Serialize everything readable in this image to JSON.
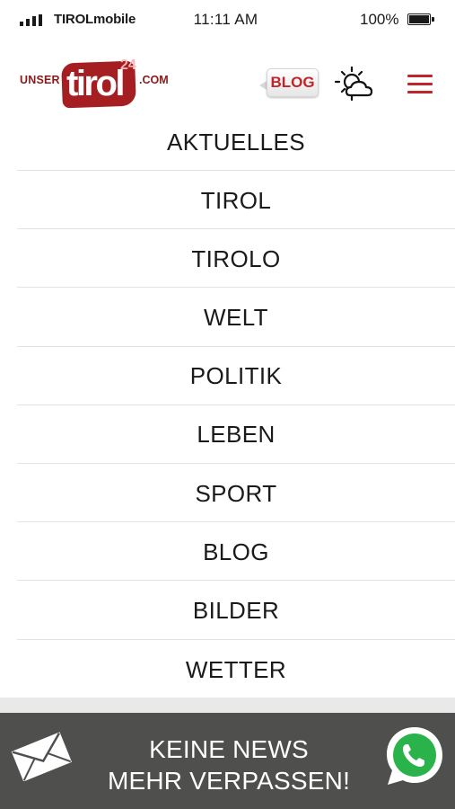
{
  "status_bar": {
    "carrier": "TIROLmobile",
    "time": "11:11 AM",
    "battery": "100%",
    "signal_icon": "signal-bars-icon",
    "battery_icon": "battery-full-icon"
  },
  "header": {
    "logo": {
      "prefix": "UNSER",
      "name": "tirol",
      "superscript": "24",
      "suffix": ".COM"
    },
    "blog_badge": "BLOG",
    "weather_icon": "sun-cloud-icon",
    "menu_icon": "hamburger-menu-icon"
  },
  "nav": {
    "items": [
      {
        "label": "AKTUELLES"
      },
      {
        "label": "TIROL"
      },
      {
        "label": "TIROLO"
      },
      {
        "label": "WELT"
      },
      {
        "label": "POLITIK"
      },
      {
        "label": "LEBEN"
      },
      {
        "label": "SPORT"
      },
      {
        "label": "BLOG"
      },
      {
        "label": "BILDER"
      },
      {
        "label": "WETTER"
      }
    ]
  },
  "banner": {
    "line1": "KEINE NEWS",
    "line2": "MEHR VERPASSEN!",
    "left_icon": "envelope-icon",
    "right_icon": "whatsapp-icon"
  },
  "colors": {
    "accent": "#c0252b",
    "logo_red": "#a41e22",
    "banner_bg": "#4f4f4d",
    "divider": "#e2e2e2"
  }
}
